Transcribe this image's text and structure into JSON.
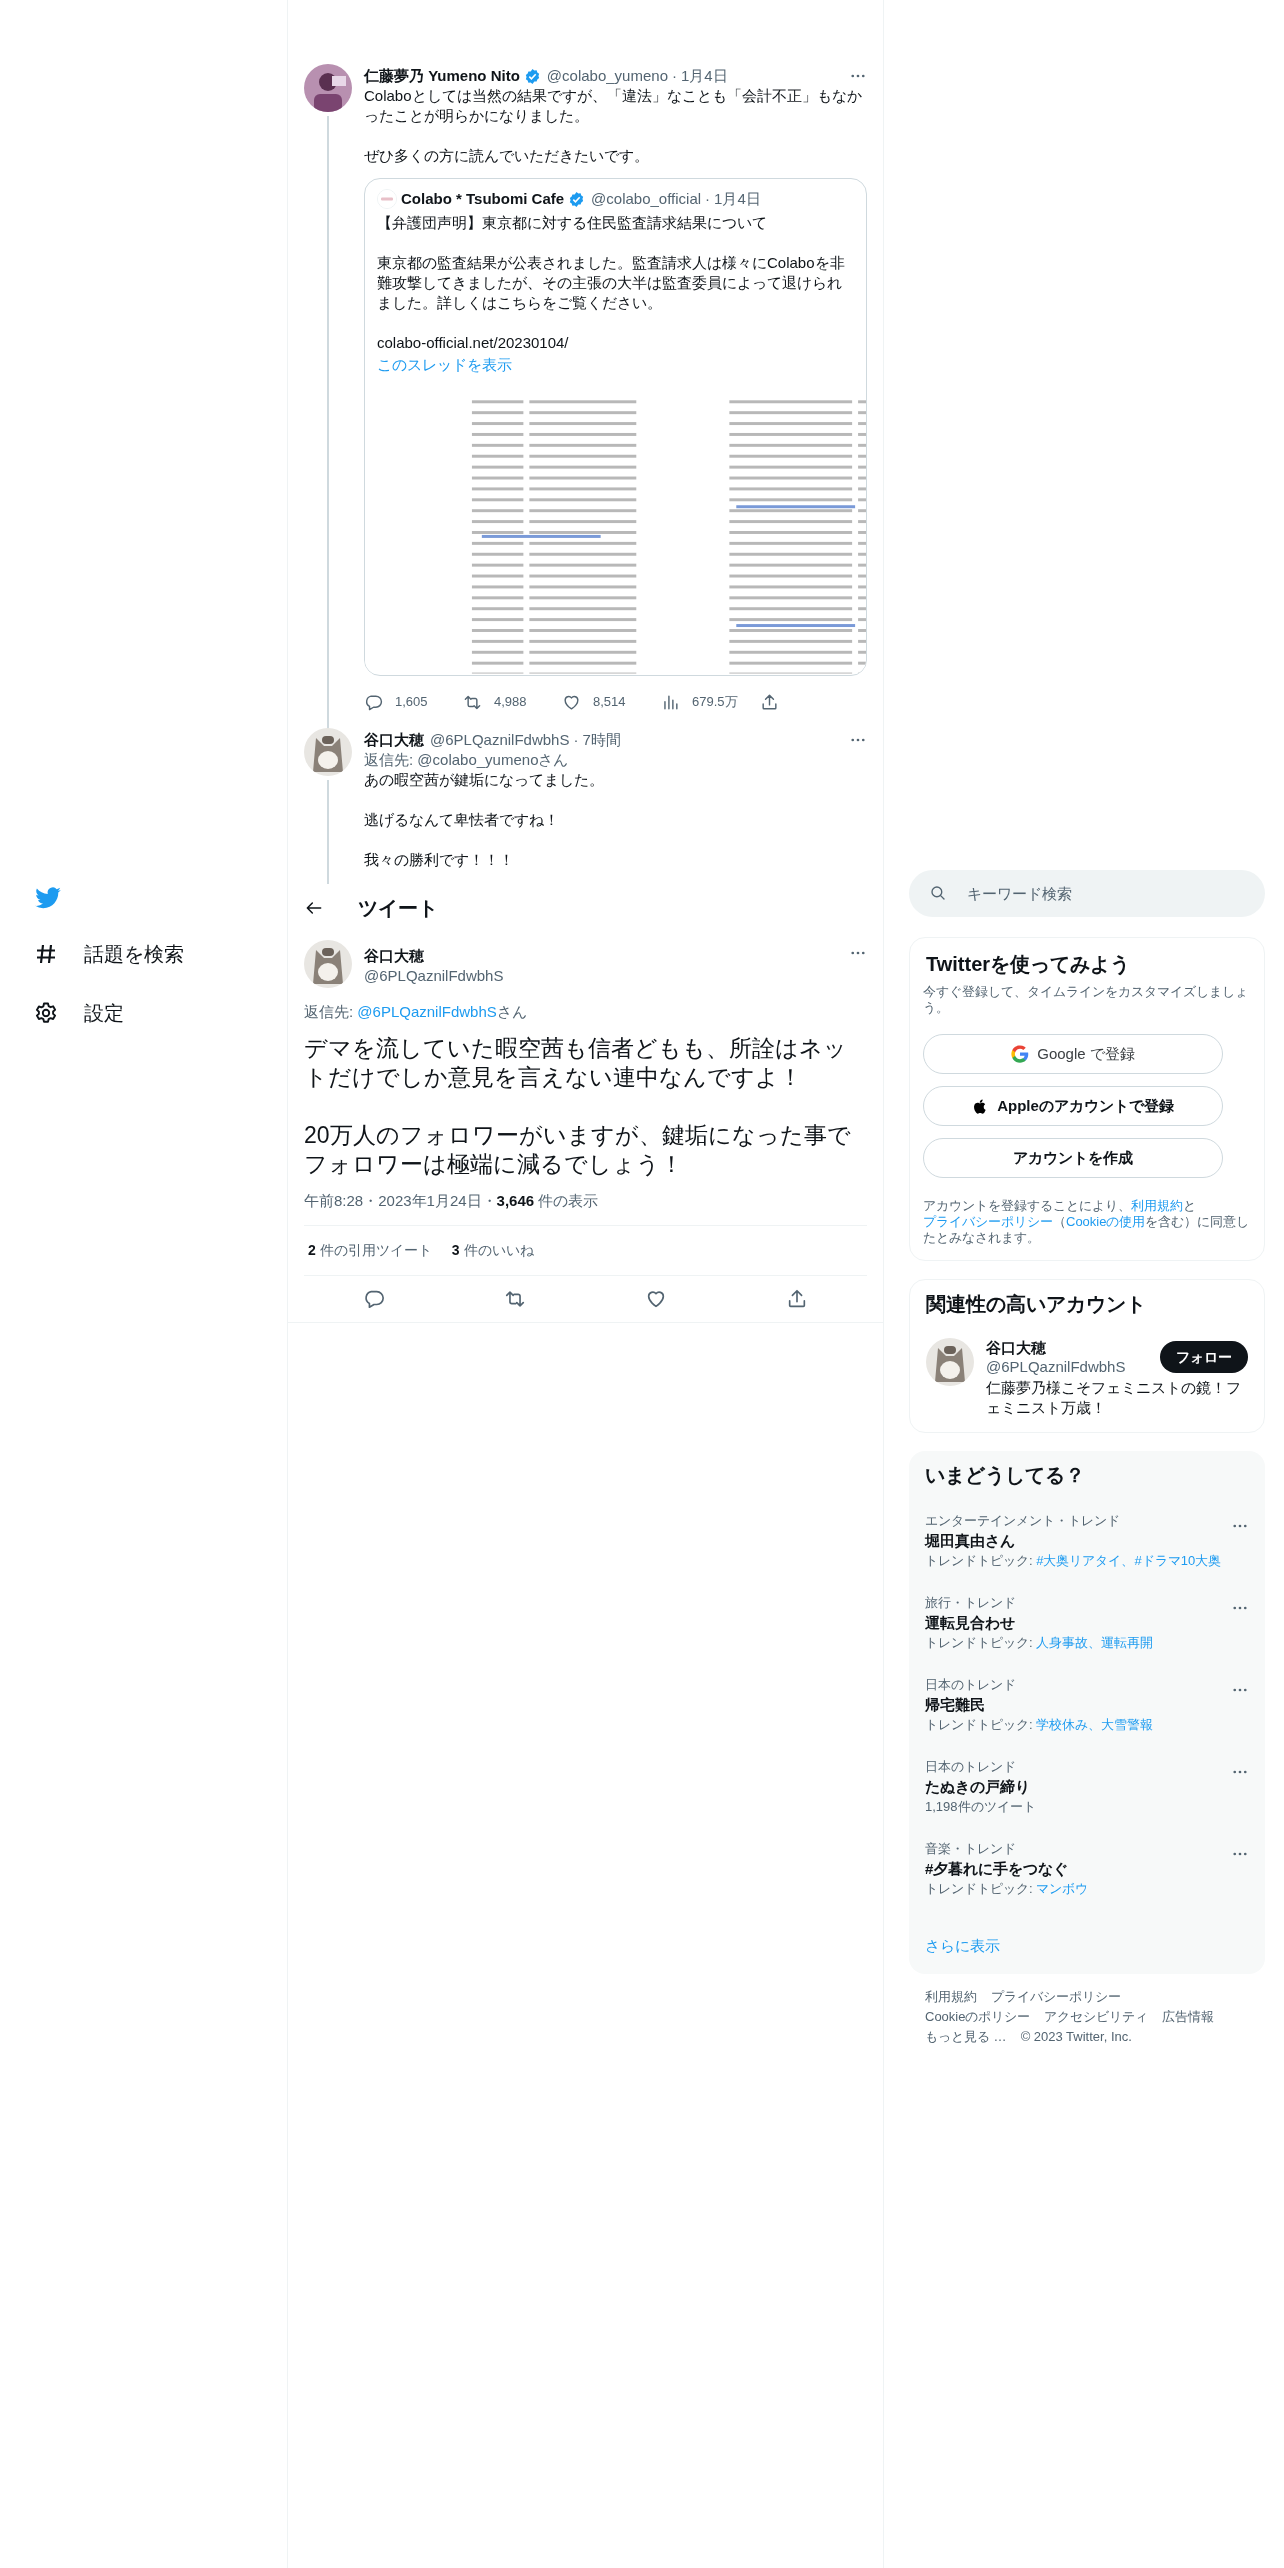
{
  "sidebar": {
    "items": [
      {
        "kind": "explore",
        "label": "話題を検索"
      },
      {
        "kind": "settings",
        "label": "設定"
      }
    ]
  },
  "thread": [
    {
      "name": "仁藤夢乃 Yumeno Nito",
      "verified": true,
      "handle": "@colabo_yumeno",
      "separator": "·",
      "time": "1月4日",
      "text": [
        "Colaboとしては当然の結果ですが、「違法」なことも「会計不正」もなかったことが明らかになりました。",
        "ぜひ多くの方に読んでいただきたいです。"
      ],
      "quote": {
        "name": "Colabo * Tsubomi Cafe",
        "verified": true,
        "handle": "@colabo_official",
        "separator": "·",
        "time": "1月4日",
        "text": [
          "【弁護団声明】東京都に対する住民監査請求結果について",
          "東京都の監査結果が公表されました。監査請求人は様々にColaboを非難攻撃してきましたが、その主張の大半は監査委員によって退けられました。詳しくはこちらをご覧ください。",
          "colabo-official.net/20230104/"
        ],
        "link": "このスレッドを表示",
        "media": {
          "kind": "picture"
        }
      },
      "actions": [
        {
          "kind": "reply",
          "count": "1,605"
        },
        {
          "kind": "retweet",
          "count": "4,988"
        },
        {
          "kind": "like",
          "count": "8,514"
        },
        {
          "kind": "views",
          "count": "679.5万"
        },
        {
          "kind": "share"
        }
      ]
    },
    {
      "name": "谷口大穂",
      "verified": false,
      "handle": "@6PLQaznilFdwbhS",
      "separator": "·",
      "time": "7時間",
      "reply_to": "返信先: @colabo_yumenoさん",
      "text": [
        "あの暇空茜が鍵垢になってました。",
        "逃げるなんて卑怯者ですね！",
        "我々の勝利です！！！"
      ]
    }
  ],
  "header": {
    "title": "ツイート"
  },
  "main_tweet": {
    "name": "谷口大穂",
    "handle": "@6PLQaznilFdwbhS",
    "reply_prefix": "返信先: ",
    "reply_handle": "@6PLQaznilFdwbhS",
    "reply_suffix": "さん",
    "text": [
      "デマを流していた暇空茜も信者どもも、所詮はネットだけでしか意見を言えない連中なんですよ！",
      "20万人のフォロワーがいますが、鍵垢になった事でフォロワーは極端に減るでしょう！"
    ],
    "timestamp": "午前8:28・2023年1月24日・",
    "views_count": "3,646",
    "views_label": "件の表示",
    "stats": [
      {
        "count": "2",
        "label": "件の引用ツイート"
      },
      {
        "count": "3",
        "label": "件のいいね"
      }
    ],
    "actions": [
      {
        "kind": "reply"
      },
      {
        "kind": "retweet"
      },
      {
        "kind": "like"
      },
      {
        "kind": "share"
      }
    ]
  },
  "search": {
    "placeholder": "キーワード検索"
  },
  "signup": {
    "title": "Twitterを使ってみよう",
    "subtitle": "今すぐ登録して、タイムラインをカスタマイズしましょう。",
    "buttons": [
      {
        "kind": "google",
        "label": "Google で登録"
      },
      {
        "kind": "apple",
        "label": "Appleのアカウントで登録"
      },
      {
        "kind": "plain",
        "label": "アカウントを作成"
      }
    ],
    "legal": [
      {
        "text": "アカウントを登録することにより、",
        "link": false
      },
      {
        "text": "利用規約",
        "link": true
      },
      {
        "text": "と",
        "link": false
      },
      {
        "text": "プライバシーポリシー",
        "link": true
      },
      {
        "text": "（",
        "link": false
      },
      {
        "text": "Cookieの使用",
        "link": true
      },
      {
        "text": "を含む）に同意したとみなされます。",
        "link": false
      }
    ]
  },
  "related": {
    "title": "関連性の高いアカウント",
    "accounts": [
      {
        "name": "谷口大穂",
        "handle": "@6PLQaznilFdwbhS",
        "bio": "仁藤夢乃様こそフェミニストの鏡！フェミニスト万歳！",
        "button": "フォロー"
      }
    ]
  },
  "trends": {
    "title": "いまどうしてる？",
    "items": [
      {
        "kind": "topics",
        "context": "エンターテインメント・トレンド",
        "name": "堀田真由さん",
        "label": "トレンドトピック: ",
        "topics": "#大奥リアタイ、#ドラマ10大奥"
      },
      {
        "kind": "topics",
        "context": "旅行・トレンド",
        "name": "運転見合わせ",
        "label": "トレンドトピック: ",
        "topics": "人身事故、運転再開"
      },
      {
        "kind": "topics",
        "context": "日本のトレンド",
        "name": "帰宅難民",
        "label": "トレンドトピック: ",
        "topics": "学校休み、大雪警報"
      },
      {
        "kind": "count",
        "context": "日本のトレンド",
        "name": "たぬきの戸締り",
        "count": "1,198件のツイート"
      },
      {
        "kind": "topics",
        "context": "音楽・トレンド",
        "name": "#夕暮れに手をつなぐ",
        "label": "トレンドトピック: ",
        "topics": "マンボウ"
      }
    ],
    "more": "さらに表示"
  },
  "footer": [
    [
      "利用規約",
      "プライバシーポリシー"
    ],
    [
      "Cookieのポリシー",
      "アクセシビリティ",
      "広告情報"
    ],
    [
      "もっと見る …",
      "© 2023 Twitter, Inc."
    ]
  ]
}
